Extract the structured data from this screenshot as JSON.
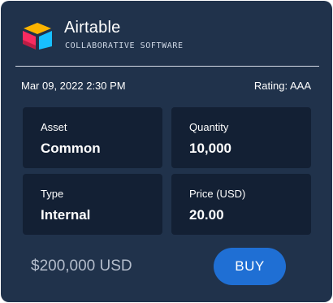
{
  "brand": {
    "name": "Airtable",
    "subtitle": "COLLABORATIVE SOFTWARE",
    "logo_icon": "airtable-logo-icon",
    "logo_colors": {
      "top": "#fcb400",
      "right": "#18bfff",
      "left": "#f82b60",
      "shade": "#ba1e45"
    }
  },
  "meta": {
    "datetime": "Mar 09, 2022 2:30 PM",
    "rating": "Rating: AAA"
  },
  "details": [
    {
      "label": "Asset",
      "value": "Common"
    },
    {
      "label": "Quantity",
      "value": "10,000"
    },
    {
      "label": "Type",
      "value": "Internal"
    },
    {
      "label": "Price (USD)",
      "value": "20.00"
    }
  ],
  "footer": {
    "total": "$200,000 USD",
    "buy_label": "BUY"
  },
  "colors": {
    "card_background": "#20324b",
    "tile_background": "#132034",
    "accent": "#1f6fd4",
    "muted_text": "#b3bccb"
  }
}
